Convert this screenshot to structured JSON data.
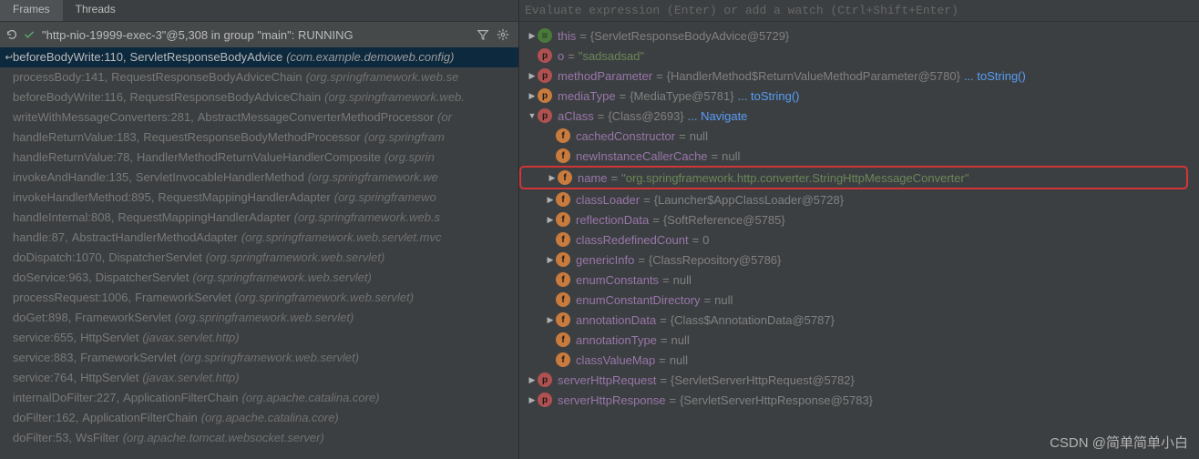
{
  "tabs": {
    "frames": "Frames",
    "threads": "Threads"
  },
  "thread_bar": {
    "text": "\"http-nio-19999-exec-3\"@5,308 in group \"main\": RUNNING"
  },
  "stack": [
    {
      "method": "beforeBodyWrite",
      "line": "110",
      "cls": "ServletResponseBodyAdvice",
      "pkg": "(com.example.demoweb.config)",
      "selected": true,
      "dimmed": false
    },
    {
      "method": "processBody",
      "line": "141",
      "cls": "RequestResponseBodyAdviceChain",
      "pkg": "(org.springframework.web.se",
      "dimmed": true
    },
    {
      "method": "beforeBodyWrite",
      "line": "116",
      "cls": "RequestResponseBodyAdviceChain",
      "pkg": "(org.springframework.web.",
      "dimmed": true
    },
    {
      "method": "writeWithMessageConverters",
      "line": "281",
      "cls": "AbstractMessageConverterMethodProcessor",
      "pkg": "(or",
      "dimmed": true
    },
    {
      "method": "handleReturnValue",
      "line": "183",
      "cls": "RequestResponseBodyMethodProcessor",
      "pkg": "(org.springfram",
      "dimmed": true
    },
    {
      "method": "handleReturnValue",
      "line": "78",
      "cls": "HandlerMethodReturnValueHandlerComposite",
      "pkg": "(org.sprin",
      "dimmed": true
    },
    {
      "method": "invokeAndHandle",
      "line": "135",
      "cls": "ServletInvocableHandlerMethod",
      "pkg": "(org.springframework.we",
      "dimmed": true
    },
    {
      "method": "invokeHandlerMethod",
      "line": "895",
      "cls": "RequestMappingHandlerAdapter",
      "pkg": "(org.springframewo",
      "dimmed": true
    },
    {
      "method": "handleInternal",
      "line": "808",
      "cls": "RequestMappingHandlerAdapter",
      "pkg": "(org.springframework.web.s",
      "dimmed": true
    },
    {
      "method": "handle",
      "line": "87",
      "cls": "AbstractHandlerMethodAdapter",
      "pkg": "(org.springframework.web.servlet.mvc",
      "dimmed": true
    },
    {
      "method": "doDispatch",
      "line": "1070",
      "cls": "DispatcherServlet",
      "pkg": "(org.springframework.web.servlet)",
      "dimmed": true
    },
    {
      "method": "doService",
      "line": "963",
      "cls": "DispatcherServlet",
      "pkg": "(org.springframework.web.servlet)",
      "dimmed": true
    },
    {
      "method": "processRequest",
      "line": "1006",
      "cls": "FrameworkServlet",
      "pkg": "(org.springframework.web.servlet)",
      "dimmed": true
    },
    {
      "method": "doGet",
      "line": "898",
      "cls": "FrameworkServlet",
      "pkg": "(org.springframework.web.servlet)",
      "dimmed": true
    },
    {
      "method": "service",
      "line": "655",
      "cls": "HttpServlet",
      "pkg": "(javax.servlet.http)",
      "dimmed": true
    },
    {
      "method": "service",
      "line": "883",
      "cls": "FrameworkServlet",
      "pkg": "(org.springframework.web.servlet)",
      "dimmed": true
    },
    {
      "method": "service",
      "line": "764",
      "cls": "HttpServlet",
      "pkg": "(javax.servlet.http)",
      "dimmed": true
    },
    {
      "method": "internalDoFilter",
      "line": "227",
      "cls": "ApplicationFilterChain",
      "pkg": "(org.apache.catalina.core)",
      "dimmed": true
    },
    {
      "method": "doFilter",
      "line": "162",
      "cls": "ApplicationFilterChain",
      "pkg": "(org.apache.catalina.core)",
      "dimmed": true
    },
    {
      "method": "doFilter",
      "line": "53",
      "cls": "WsFilter",
      "pkg": "(org.apache.tomcat.websocket.server)",
      "dimmed": true
    }
  ],
  "eval_hint": "Evaluate expression (Enter) or add a watch (Ctrl+Shift+Enter)",
  "vars": {
    "this": {
      "name": "this",
      "val": "{ServletResponseBodyAdvice@5729}"
    },
    "o": {
      "name": "o",
      "val": "\"sadsadsad\""
    },
    "methodParameter": {
      "name": "methodParameter",
      "val": "{HandlerMethod$ReturnValueMethodParameter@5780}",
      "link": "... toString()"
    },
    "mediaType": {
      "name": "mediaType",
      "val": "{MediaType@5781}",
      "link": "... toString()"
    },
    "aClass": {
      "name": "aClass",
      "val": "{Class@2693}",
      "link": "... Navigate",
      "children": {
        "cachedConstructor": {
          "name": "cachedConstructor",
          "val": "null"
        },
        "newInstanceCallerCache": {
          "name": "newInstanceCallerCache",
          "val": "null"
        },
        "name": {
          "name": "name",
          "val": "\"org.springframework.http.converter.StringHttpMessageConverter\""
        },
        "classLoader": {
          "name": "classLoader",
          "val": "{Launcher$AppClassLoader@5728}"
        },
        "reflectionData": {
          "name": "reflectionData",
          "val": "{SoftReference@5785}"
        },
        "classRedefinedCount": {
          "name": "classRedefinedCount",
          "val": "0"
        },
        "genericInfo": {
          "name": "genericInfo",
          "val": "{ClassRepository@5786}"
        },
        "enumConstants": {
          "name": "enumConstants",
          "val": "null"
        },
        "enumConstantDirectory": {
          "name": "enumConstantDirectory",
          "val": "null"
        },
        "annotationData": {
          "name": "annotationData",
          "val": "{Class$AnnotationData@5787}"
        },
        "annotationType": {
          "name": "annotationType",
          "val": "null"
        },
        "classValueMap": {
          "name": "classValueMap",
          "val": "null"
        }
      }
    },
    "serverHttpRequest": {
      "name": "serverHttpRequest",
      "val": "{ServletServerHttpRequest@5782}"
    },
    "serverHttpResponse": {
      "name": "serverHttpResponse",
      "val": "{ServletServerHttpResponse@5783}"
    }
  },
  "watermark": "CSDN @简单简单小白"
}
